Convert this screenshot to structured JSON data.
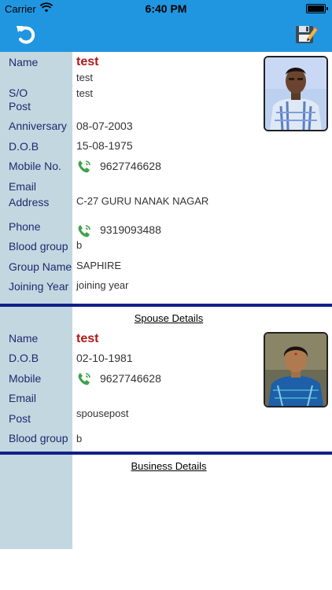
{
  "status_bar": {
    "carrier": "Carrier",
    "time": "6:40 PM"
  },
  "nav": {
    "back_icon": "undo-arrow-icon",
    "save_icon": "save-edit-icon"
  },
  "member": {
    "labels": {
      "name": "Name",
      "so": "S/O",
      "post": "Post",
      "anniversary": "Anniversary",
      "dob": "D.O.B",
      "mobile": "Mobile No.",
      "email": "Email",
      "address": "Address",
      "phone": "Phone",
      "blood_group": "Blood group",
      "group_name": "Group Name",
      "joining_year": "Joining Year"
    },
    "name": "test",
    "so": "test",
    "post": "test",
    "anniversary": "08-07-2003",
    "dob": "15-08-1975",
    "mobile": "9627746628",
    "email": "",
    "address": "C-27 GURU NANAK NAGAR",
    "phone": "9319093488",
    "blood_group": "b",
    "group_name": "SAPHIRE",
    "joining_year": "joining year"
  },
  "spouse": {
    "section_title": "Spouse Details",
    "labels": {
      "name": "Name",
      "dob": "D.O.B",
      "mobile": "Mobile",
      "email": "Email",
      "post": "Post",
      "blood_group": "Blood group"
    },
    "name": "test",
    "dob": "02-10-1981",
    "mobile": "9627746628",
    "email": "",
    "post": "spousepost",
    "blood_group": "b"
  },
  "business": {
    "section_title": "Business Details"
  },
  "colors": {
    "nav_blue": "#2196e0",
    "label_column": "#c3d7e1",
    "label_text": "#1f2a6c",
    "name_red": "#b01818",
    "divider": "#12208a"
  }
}
